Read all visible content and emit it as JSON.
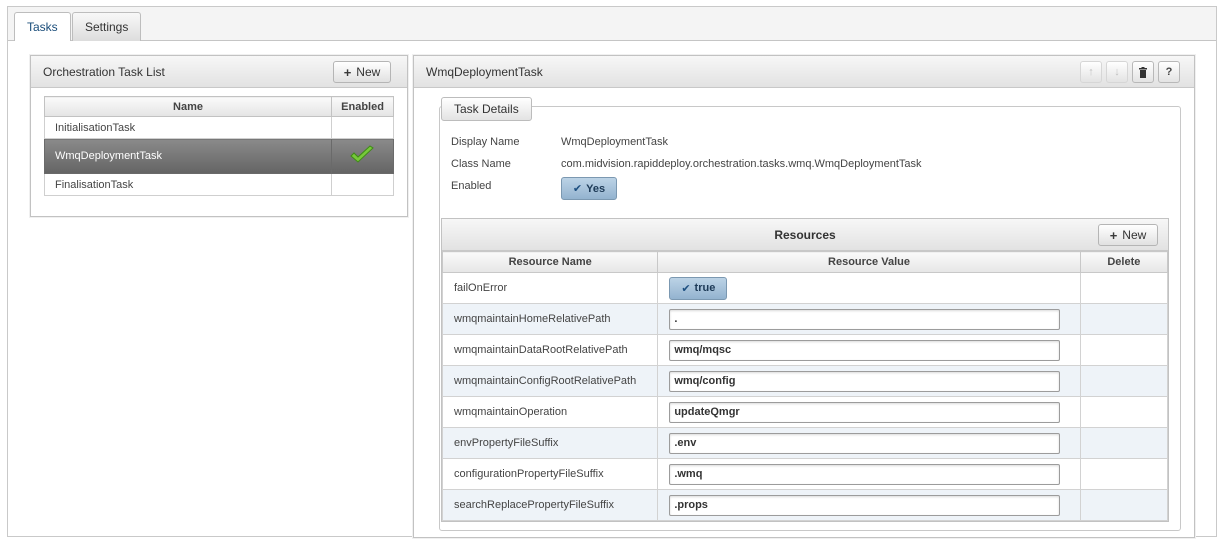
{
  "tabs": [
    {
      "label": "Tasks",
      "active": true
    },
    {
      "label": "Settings",
      "active": false
    }
  ],
  "task_list": {
    "title": "Orchestration Task List",
    "new_label": "New",
    "columns": [
      "Name",
      "Enabled"
    ],
    "rows": [
      {
        "name": "InitialisationTask",
        "enabled": false
      },
      {
        "name": "WmqDeploymentTask",
        "enabled": true,
        "selected": true
      },
      {
        "name": "FinalisationTask",
        "enabled": false
      }
    ]
  },
  "detail": {
    "title": "WmqDeploymentTask",
    "toolbar_icons": [
      "arrow-up-icon",
      "arrow-down-icon",
      "trash-icon",
      "help-icon"
    ],
    "help_label": "?",
    "task_details_label": "Task Details",
    "display_name_label": "Display Name",
    "display_name_value": "WmqDeploymentTask",
    "class_name_label": "Class Name",
    "class_name_value": "com.midvision.rapiddeploy.orchestration.tasks.wmq.WmqDeploymentTask",
    "enabled_label": "Enabled",
    "enabled_value": "Yes"
  },
  "resources": {
    "title": "Resources",
    "new_label": "New",
    "columns": [
      "Resource Name",
      "Resource Value",
      "Delete"
    ],
    "rows": [
      {
        "name": "failOnError",
        "type": "toggle",
        "value": "true"
      },
      {
        "name": "wmqmaintainHomeRelativePath",
        "type": "text",
        "value": "."
      },
      {
        "name": "wmqmaintainDataRootRelativePath",
        "type": "text",
        "value": "wmq/mqsc"
      },
      {
        "name": "wmqmaintainConfigRootRelativePath",
        "type": "text",
        "value": "wmq/config"
      },
      {
        "name": "wmqmaintainOperation",
        "type": "text",
        "value": "updateQmgr"
      },
      {
        "name": "envPropertyFileSuffix",
        "type": "text",
        "value": ".env"
      },
      {
        "name": "configurationPropertyFileSuffix",
        "type": "text",
        "value": ".wmq"
      },
      {
        "name": "searchReplacePropertyFileSuffix",
        "type": "text",
        "value": ".props"
      }
    ]
  },
  "colors": {
    "selected_row": "#777777",
    "check_green": "#6fbf2a",
    "toggle_blue": "#a8c4dc"
  }
}
